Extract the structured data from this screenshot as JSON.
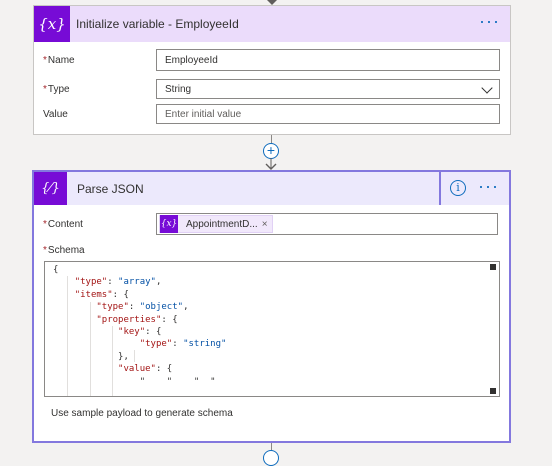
{
  "init_variable": {
    "title": "Initialize variable - EmployeeId",
    "name_label": "Name",
    "name_value": "EmployeeId",
    "type_label": "Type",
    "type_value": "String",
    "value_label": "Value",
    "value_placeholder": "Enter initial value",
    "more_label": "···",
    "icon_glyph": "{x}",
    "required_marker": "*"
  },
  "connector": {
    "plus_glyph": "+"
  },
  "parse_json": {
    "title": "Parse JSON",
    "icon_glyph": "{⁄}",
    "info_glyph": "i",
    "more_label": "···",
    "content_label": "Content",
    "content_token": {
      "icon_glyph": "{x}",
      "label": "AppointmentD...",
      "close_glyph": "×"
    },
    "schema_label": "Schema",
    "schema_lines": [
      "{",
      "    \"type\": \"array\",",
      "    \"items\": {",
      "        \"type\": \"object\",",
      "        \"properties\": {",
      "            \"key\": {",
      "                \"type\": \"string\"",
      "            },",
      "            \"value\": {",
      "                \"    \"    \"  \""
    ],
    "sample_link": "Use sample payload to generate schema"
  },
  "colors": {
    "accent": "#770bd6",
    "link": "#0f6cbd",
    "card_border": "#8378de"
  }
}
